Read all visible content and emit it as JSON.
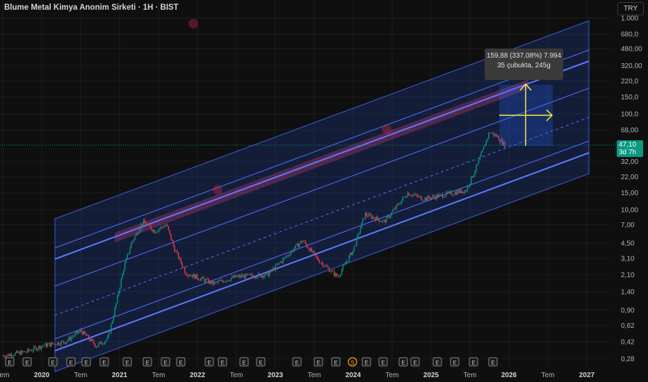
{
  "header": {
    "title": "Blume Metal Kimya Anonim Sirketi · 1H · BIST",
    "currency": "TRY"
  },
  "price_axis": [
    "1.000",
    "680,0",
    "480,00",
    "320,00",
    "220,0",
    "150,0",
    "100,0",
    "68,00",
    "32,00",
    "22,00",
    "15,00",
    "10,00",
    "7,00",
    "4,50",
    "3,10",
    "2,10",
    "1,40",
    "0,90",
    "0,62",
    "0,42",
    "0,28"
  ],
  "time_axis": [
    {
      "label": "Tem",
      "year": 2019.5
    },
    {
      "label": "2020",
      "year": 2020
    },
    {
      "label": "Tem",
      "year": 2020.5
    },
    {
      "label": "2021",
      "year": 2021
    },
    {
      "label": "Tem",
      "year": 2021.5
    },
    {
      "label": "2022",
      "year": 2022
    },
    {
      "label": "Tem",
      "year": 2022.5
    },
    {
      "label": "2023",
      "year": 2023
    },
    {
      "label": "Tem",
      "year": 2023.5
    },
    {
      "label": "2024",
      "year": 2024
    },
    {
      "label": "Tem",
      "year": 2024.5
    },
    {
      "label": "2025",
      "year": 2025
    },
    {
      "label": "Tem",
      "year": 2025.5
    },
    {
      "label": "2026",
      "year": 2026
    },
    {
      "label": "Tem",
      "year": 2026.5
    },
    {
      "label": "2027",
      "year": 2027
    }
  ],
  "last_price": {
    "value": "47,10",
    "countdown": "3d 7h",
    "color": "#089981"
  },
  "measure": {
    "line1": "159,88 (337,08%) 7.994",
    "line2": "35 çubukta, 245g",
    "color": "#ffeb3b"
  },
  "chart_data": {
    "type": "candlestick",
    "scale": "log",
    "ylim": [
      0.28,
      1000
    ],
    "xlim": [
      2019.45,
      2027.1
    ],
    "up_color": "#089981",
    "down_color": "#f23645",
    "closes": [
      [
        2019.5,
        0.3
      ],
      [
        2019.8,
        0.33
      ],
      [
        2020.0,
        0.38
      ],
      [
        2020.3,
        0.42
      ],
      [
        2020.5,
        0.55
      ],
      [
        2020.7,
        0.38
      ],
      [
        2020.85,
        0.45
      ],
      [
        2020.95,
        1.0
      ],
      [
        2021.05,
        2.4
      ],
      [
        2021.15,
        4.5
      ],
      [
        2021.3,
        7.5
      ],
      [
        2021.45,
        6
      ],
      [
        2021.6,
        7
      ],
      [
        2021.7,
        4
      ],
      [
        2021.85,
        2.2
      ],
      [
        2022.2,
        1.7
      ],
      [
        2022.5,
        2.0
      ],
      [
        2022.9,
        2.1
      ],
      [
        2023.35,
        4.8
      ],
      [
        2023.55,
        3.0
      ],
      [
        2023.8,
        2.0
      ],
      [
        2024.0,
        3.8
      ],
      [
        2024.15,
        9
      ],
      [
        2024.4,
        7.5
      ],
      [
        2024.7,
        15
      ],
      [
        2024.9,
        13
      ],
      [
        2025.2,
        14.5
      ],
      [
        2025.45,
        16
      ],
      [
        2025.6,
        30
      ],
      [
        2025.75,
        65
      ],
      [
        2025.85,
        58
      ],
      [
        2025.95,
        47.1
      ]
    ],
    "earnings_markers": [
      "E",
      "E",
      "E",
      "E",
      "E",
      "E",
      "E",
      "E",
      "E",
      "E",
      "E",
      "E",
      "E",
      "E",
      "E",
      "E",
      "E",
      "S",
      "E",
      "E",
      "E",
      "E",
      "E",
      "E",
      "E",
      "E"
    ]
  }
}
